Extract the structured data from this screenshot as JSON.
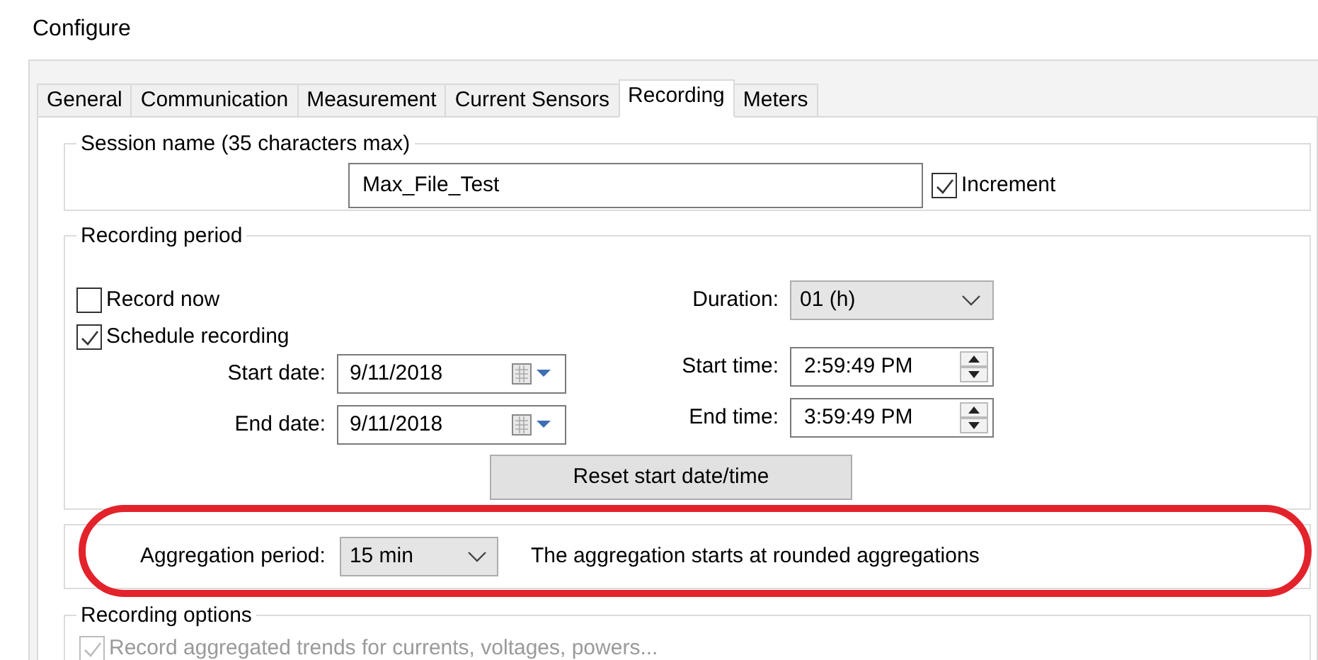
{
  "window": {
    "title": "Configure"
  },
  "tabs": [
    {
      "label": "General",
      "selected": false
    },
    {
      "label": "Communication",
      "selected": false
    },
    {
      "label": "Measurement",
      "selected": false
    },
    {
      "label": "Current Sensors",
      "selected": false
    },
    {
      "label": "Recording",
      "selected": true
    },
    {
      "label": "Meters",
      "selected": false
    }
  ],
  "session": {
    "legend": "Session name (35 characters max)",
    "value": "Max_File_Test",
    "increment": {
      "label": "Increment",
      "checked": true
    }
  },
  "recording_period": {
    "legend": "Recording period",
    "options": [
      {
        "label": "Record now",
        "checked": false
      },
      {
        "label": "Schedule recording",
        "checked": true
      }
    ],
    "start_date": {
      "label": "Start date:",
      "value": "9/11/2018"
    },
    "end_date": {
      "label": "End date:",
      "value": "9/11/2018"
    },
    "duration": {
      "label": "Duration:",
      "value": "01 (h)"
    },
    "start_time": {
      "label": "Start time:",
      "value": "2:59:49 PM"
    },
    "end_time": {
      "label": "End time:",
      "value": "3:59:49 PM"
    },
    "reset_button": "Reset start date/time"
  },
  "aggregation": {
    "label": "Aggregation period:",
    "value": "15 min",
    "note": "The aggregation starts at rounded aggregations"
  },
  "recording_options": {
    "legend": "Recording options",
    "items": [
      {
        "label": "Record aggregated trends for currents, voltages, powers...",
        "checked": true,
        "disabled": true
      }
    ]
  }
}
